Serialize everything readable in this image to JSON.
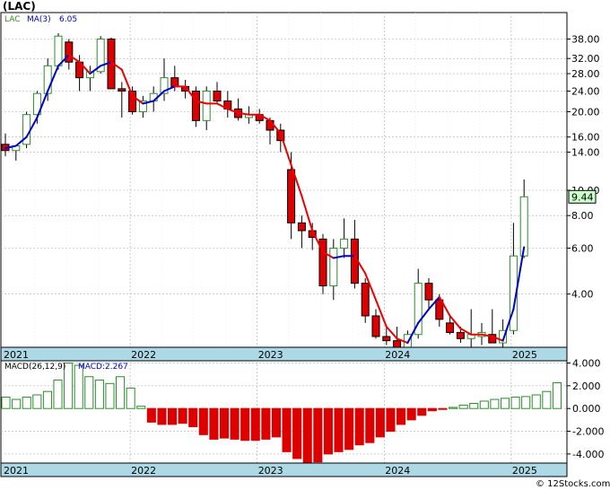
{
  "title": "(LAC)",
  "copyright": "© 12Stocks.com",
  "colors": {
    "up": "#2e8b2e",
    "down": "#dd0000",
    "ma_up": "#0000cc",
    "ma_down": "#ee0000",
    "axis_band": "#add8e6",
    "price_box": "#ccffcc",
    "grid": "#aaaaaa"
  },
  "chart_data": [
    {
      "type": "candlestick",
      "scale": "log",
      "legend": {
        "symbol": "LAC",
        "ma_label": "MA(3)",
        "ma_value": "6.05"
      },
      "last_price": "9.44",
      "y_ticks": [
        "38.00",
        "32.00",
        "28.00",
        "24.00",
        "20.00",
        "16.00",
        "14.00",
        "10.00",
        "8.00",
        "6.00",
        "4.00"
      ],
      "x_labels": [
        "2021",
        "2022",
        "2023",
        "2024",
        "2025"
      ],
      "ylim": [
        2.5,
        48
      ],
      "x": [
        "2021-10",
        "2021-11",
        "2021-12",
        "2022-01",
        "2022-02",
        "2022-03",
        "2022-04",
        "2022-05",
        "2022-06",
        "2022-07",
        "2022-08",
        "2022-09",
        "2022-10",
        "2022-11",
        "2022-12",
        "2023-01",
        "2023-02",
        "2023-03",
        "2023-04",
        "2023-05",
        "2023-06",
        "2023-07",
        "2023-08",
        "2023-09",
        "2023-10",
        "2023-11",
        "2023-12",
        "2024-01",
        "2024-02",
        "2024-03",
        "2024-04",
        "2024-05",
        "2024-06",
        "2024-07",
        "2024-08",
        "2024-09",
        "2024-10",
        "2024-11",
        "2024-12",
        "2025-01",
        "2025-02",
        "2025-03",
        "2025-04",
        "2025-05",
        "2025-06",
        "2025-07",
        "2025-08",
        "2025-09",
        "2025-10"
      ],
      "ohlc": [
        [
          15.0,
          16.5,
          13.5,
          14.2
        ],
        [
          14.2,
          14.8,
          13.0,
          14.8
        ],
        [
          15.0,
          20.0,
          14.5,
          19.5
        ],
        [
          19.5,
          24.0,
          18.0,
          23.5
        ],
        [
          23.5,
          32.0,
          22.0,
          30.0
        ],
        [
          30.0,
          40.0,
          29.0,
          39.0
        ],
        [
          37.0,
          38.0,
          29.0,
          31.0
        ],
        [
          31.0,
          33.0,
          24.0,
          27.0
        ],
        [
          27.0,
          30.0,
          24.0,
          28.5
        ],
        [
          28.5,
          39.0,
          28.0,
          38.0
        ],
        [
          38.0,
          38.5,
          26.0,
          24.5
        ],
        [
          24.5,
          26.0,
          19.0,
          24.0
        ],
        [
          24.0,
          25.0,
          19.5,
          20.0
        ],
        [
          20.0,
          23.0,
          19.0,
          22.0
        ],
        [
          22.0,
          25.0,
          20.0,
          23.5
        ],
        [
          23.5,
          32.0,
          22.0,
          27.0
        ],
        [
          27.0,
          30.0,
          24.0,
          25.0
        ],
        [
          25.0,
          26.5,
          22.5,
          24.0
        ],
        [
          24.0,
          25.0,
          17.5,
          18.5
        ],
        [
          18.5,
          25.0,
          17.0,
          24.0
        ],
        [
          24.0,
          26.0,
          21.5,
          22.0
        ],
        [
          22.0,
          24.0,
          19.0,
          20.5
        ],
        [
          20.5,
          22.5,
          18.5,
          19.0
        ],
        [
          19.0,
          21.0,
          18.0,
          19.5
        ],
        [
          19.5,
          20.5,
          18.0,
          18.5
        ],
        [
          18.5,
          19.0,
          15.0,
          17.0
        ],
        [
          17.0,
          18.0,
          14.0,
          15.5
        ],
        [
          12.0,
          14.0,
          6.5,
          7.5
        ],
        [
          7.5,
          8.0,
          6.0,
          7.0
        ],
        [
          7.0,
          7.5,
          5.9,
          6.6
        ],
        [
          6.5,
          6.8,
          4.0,
          4.3
        ],
        [
          4.3,
          6.5,
          3.8,
          6.0
        ],
        [
          6.0,
          7.8,
          5.5,
          6.5
        ],
        [
          6.5,
          7.7,
          4.2,
          4.4
        ],
        [
          4.4,
          4.6,
          3.1,
          3.3
        ],
        [
          3.3,
          3.5,
          2.7,
          2.75
        ],
        [
          2.75,
          3.0,
          2.55,
          2.65
        ],
        [
          2.65,
          3.0,
          2.2,
          2.4
        ],
        [
          2.5,
          2.9,
          2.35,
          2.8
        ],
        [
          2.8,
          5.0,
          2.7,
          4.4
        ],
        [
          4.4,
          4.6,
          3.5,
          3.8
        ],
        [
          3.8,
          4.0,
          3.0,
          3.2
        ],
        [
          3.1,
          3.3,
          2.8,
          2.85
        ],
        [
          2.85,
          3.0,
          2.6,
          2.7
        ],
        [
          2.7,
          3.5,
          2.4,
          2.8
        ],
        [
          2.75,
          3.1,
          2.55,
          2.85
        ],
        [
          2.8,
          3.5,
          2.6,
          2.6
        ],
        [
          2.6,
          3.2,
          2.5,
          2.9
        ],
        [
          2.9,
          7.5,
          2.8,
          5.6
        ],
        [
          5.6,
          11.0,
          5.5,
          9.44
        ]
      ],
      "ma": [
        14.5,
        14.8,
        16.0,
        19.0,
        24.0,
        30.0,
        33.0,
        31.0,
        28.0,
        30.0,
        31.0,
        29.0,
        23.0,
        21.5,
        22.0,
        24.0,
        25.0,
        25.0,
        22.0,
        21.5,
        21.5,
        20.5,
        19.8,
        19.5,
        19.5,
        18.5,
        16.5,
        12.5,
        9.5,
        7.0,
        5.8,
        5.5,
        5.6,
        5.6,
        4.8,
        3.8,
        3.0,
        2.7,
        2.6,
        3.1,
        3.5,
        3.9,
        3.3,
        2.95,
        2.8,
        2.8,
        2.75,
        2.65,
        3.5,
        6.05
      ],
      "ma_colors": [
        "up",
        "up",
        "up",
        "up",
        "up",
        "up",
        "up",
        "down",
        "down",
        "up",
        "up",
        "down",
        "down",
        "down",
        "up",
        "up",
        "up",
        "down",
        "down",
        "down",
        "down",
        "down",
        "down",
        "down",
        "down",
        "down",
        "down",
        "down",
        "down",
        "down",
        "down",
        "down",
        "up",
        "up",
        "down",
        "down",
        "down",
        "down",
        "down",
        "up",
        "up",
        "up",
        "down",
        "down",
        "down",
        "down",
        "down",
        "down",
        "up",
        "up"
      ]
    },
    {
      "type": "bar",
      "legend": {
        "label": "MACD(26,12,9)",
        "value_label": "MACD:2.267"
      },
      "y_ticks": [
        "4.000",
        "2.000",
        "0.000",
        "-2.000",
        "-4.000"
      ],
      "x_labels": [
        "2021",
        "2022",
        "2023",
        "2024",
        "2025"
      ],
      "ylim": [
        -4.8,
        4.2
      ],
      "values": [
        1.0,
        0.8,
        1.0,
        1.2,
        1.5,
        2.5,
        4.0,
        3.8,
        2.8,
        2.5,
        2.2,
        2.8,
        1.8,
        0.2,
        -1.2,
        -1.4,
        -1.4,
        -1.3,
        -1.6,
        -2.3,
        -2.7,
        -2.6,
        -2.7,
        -2.8,
        -2.8,
        -2.7,
        -2.5,
        -3.8,
        -4.4,
        -4.8,
        -4.7,
        -4.0,
        -3.8,
        -3.6,
        -3.2,
        -3.0,
        -2.5,
        -2.0,
        -1.4,
        -1.0,
        -0.6,
        -0.2,
        -0.05,
        0.1,
        0.3,
        0.45,
        0.65,
        0.8,
        0.9,
        1.0,
        1.05,
        1.2,
        1.5,
        2.267
      ]
    }
  ]
}
